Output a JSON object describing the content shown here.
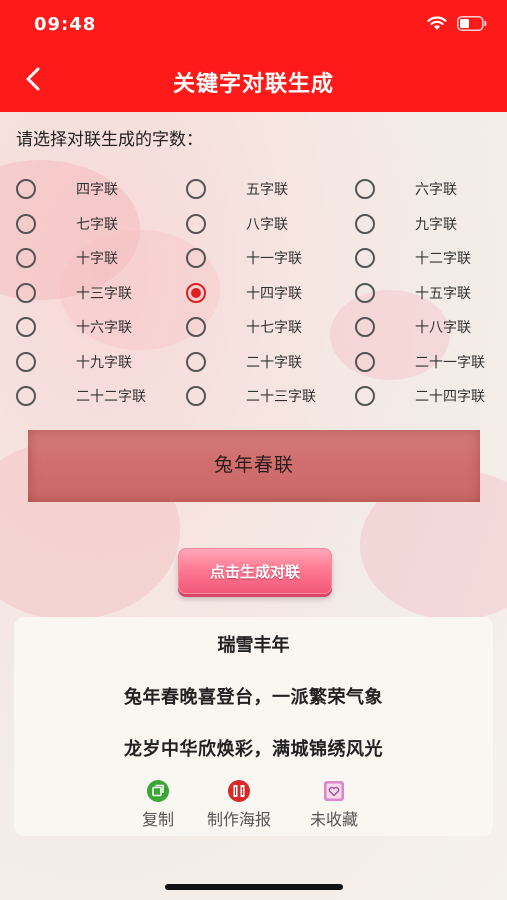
{
  "status_bar": {
    "time": "09:48"
  },
  "nav": {
    "title": "关键字对联生成"
  },
  "prompt": "请选择对联生成的字数：",
  "options": [
    [
      "四字联",
      "五字联",
      "六字联"
    ],
    [
      "七字联",
      "八字联",
      "九字联"
    ],
    [
      "十字联",
      "十一字联",
      "十二字联"
    ],
    [
      "十三字联",
      "十四字联",
      "十五字联"
    ],
    [
      "十六字联",
      "十七字联",
      "十八字联"
    ],
    [
      "十九字联",
      "二十字联",
      "二十一字联"
    ],
    [
      "二十二字联",
      "二十三字联",
      "二十四字联"
    ]
  ],
  "selected_option": "十四字联",
  "keyword": "兔年春联",
  "generate_button": "点击生成对联",
  "result": {
    "title": "瑞雪丰年",
    "line1": "兔年春晚喜登台，一派繁荣气象",
    "line2": "龙岁中华欣焕彩，满城锦绣风光"
  },
  "actions": {
    "copy": "复制",
    "poster": "制作海报",
    "favorite": "未收藏"
  },
  "colors": {
    "header": "#ff1a1a",
    "radio_selected": "#e02020",
    "copy_icon": "#3aa635",
    "poster_icon": "#d92a2a",
    "favorite_icon": "#d889c9"
  }
}
